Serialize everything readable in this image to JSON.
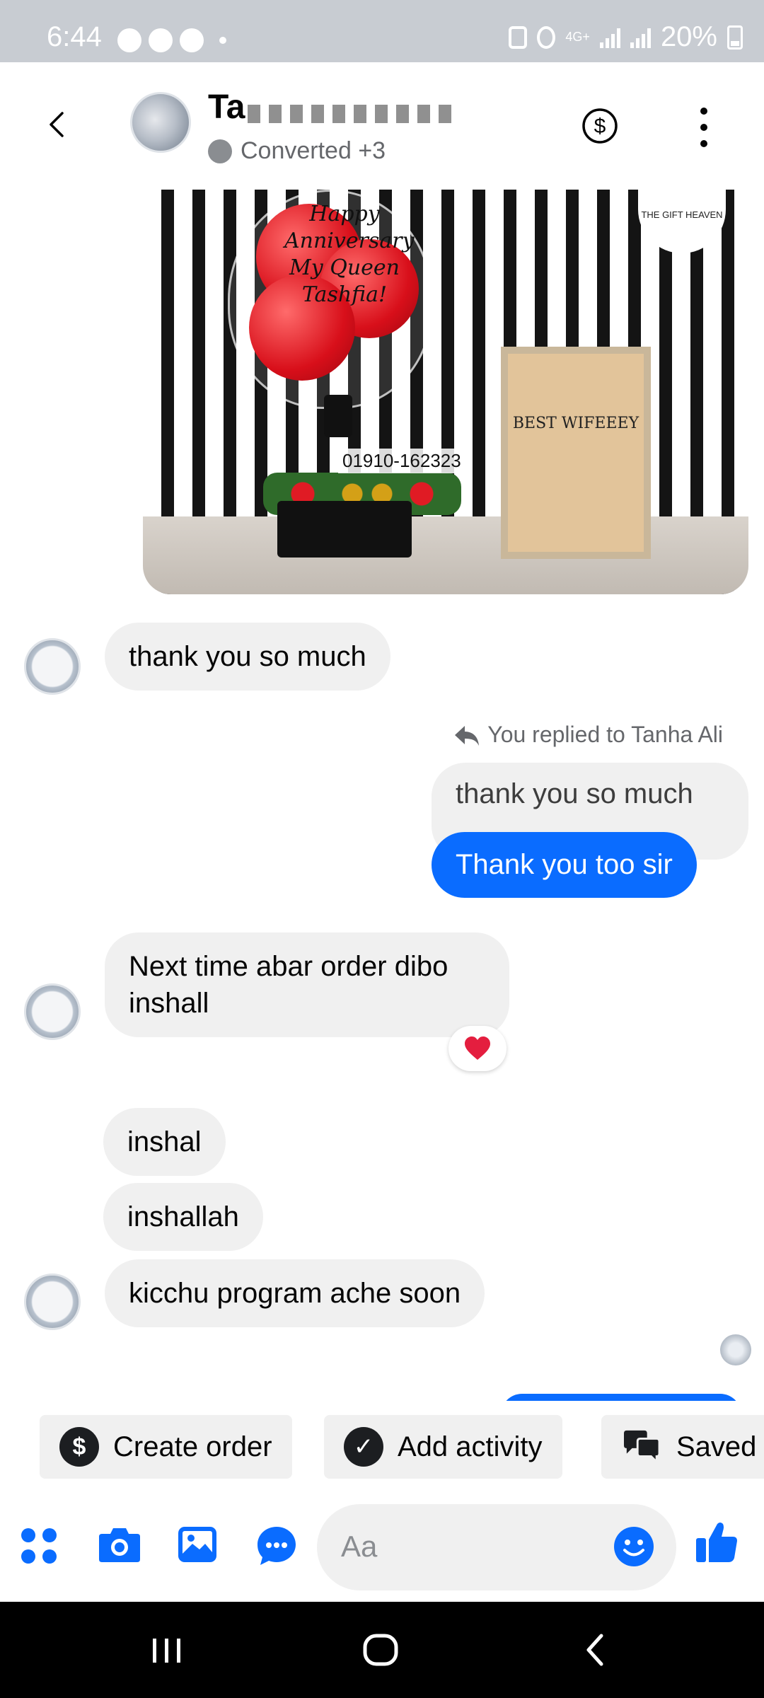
{
  "status_bar": {
    "time": "6:44",
    "network": "4G+",
    "battery": "20%"
  },
  "header": {
    "contact_name": "Ta",
    "status": "Converted +3"
  },
  "shared_image": {
    "balloon_text": [
      "Happy",
      "Anniversary",
      "My Queen",
      "Tashfia!"
    ],
    "phone_label": "01910-162323",
    "frame_title": "BEST WIFEEEY",
    "brand": "THE GIFT HEAVEN"
  },
  "messages": {
    "msg1": "thank you so much",
    "reply_label": "You replied to Tanha Ali",
    "quoted": "thank you so much",
    "msg2": "Thank you too sir",
    "msg3": "Next time abar order dibo inshall",
    "reaction": "❤️",
    "msg4": "inshal",
    "msg5": "inshallah",
    "msg6": "kicchu program ache soon"
  },
  "quick_actions": {
    "create_order": "Create order",
    "add_activity": "Add activity",
    "saved": "Saved"
  },
  "composer": {
    "placeholder": "Aa"
  },
  "colors": {
    "accent": "#0a6cff",
    "bubble_gray": "#f0f0f0"
  }
}
